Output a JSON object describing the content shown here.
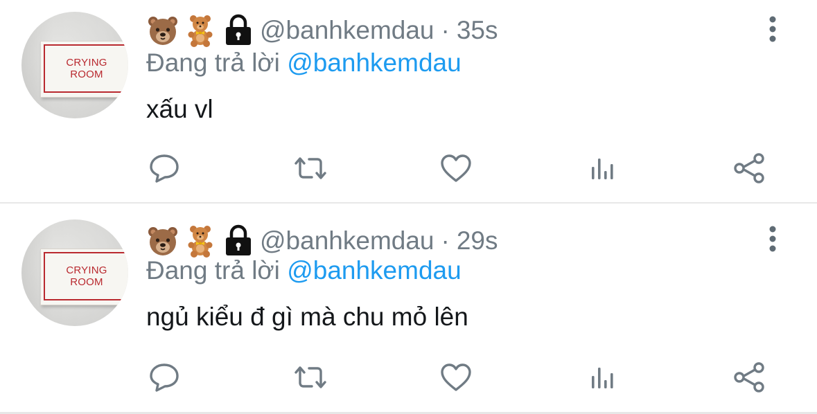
{
  "tweets": [
    {
      "avatar_sign_text": "CRYING ROOM",
      "handle": "@banhkemdau",
      "separator": "·",
      "time": "35s",
      "replying_prefix": "Đang trả lời",
      "replying_to": "@banhkemdau",
      "text": "xấu vl",
      "icons": [
        "bear-face-icon",
        "teddy-bear-icon",
        "lock-icon",
        "more-vertical-icon",
        "reply-icon",
        "retweet-icon",
        "like-icon",
        "stats-icon",
        "share-icon"
      ]
    },
    {
      "avatar_sign_text": "CRYING ROOM",
      "handle": "@banhkemdau",
      "separator": "·",
      "time": "29s",
      "replying_prefix": "Đang trả lời",
      "replying_to": "@banhkemdau",
      "text": "ngủ kiểu đ gì mà chu mỏ lên",
      "icons": [
        "bear-face-icon",
        "teddy-bear-icon",
        "lock-icon",
        "more-vertical-icon",
        "reply-icon",
        "retweet-icon",
        "like-icon",
        "stats-icon",
        "share-icon"
      ]
    }
  ],
  "colors": {
    "meta_text": "#707b84",
    "mention": "#1d9bf0",
    "body_text": "#14171a",
    "divider": "#e7e7e7",
    "sign_red": "#b9292f"
  }
}
